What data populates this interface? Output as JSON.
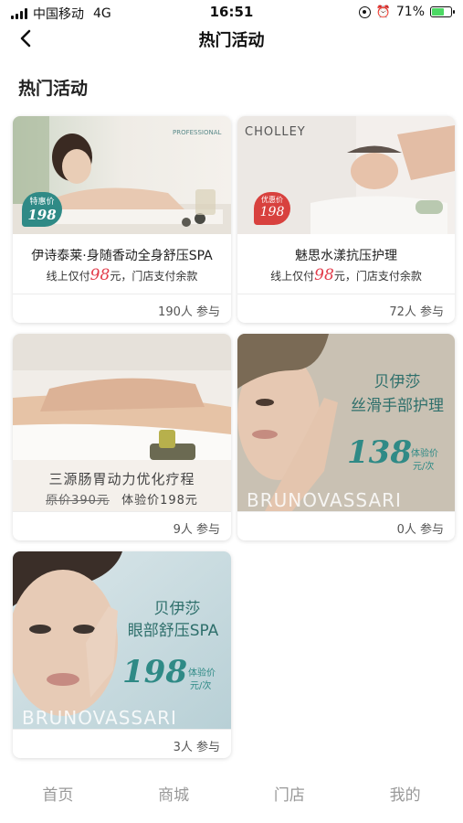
{
  "status_bar": {
    "carrier": "中国移动",
    "network": "4G",
    "time": "16:51",
    "battery": "71%",
    "battery_level": 0.71,
    "battery_color": "#4cd964"
  },
  "nav": {
    "back_icon": "chevron-left-icon",
    "title": "热门活动"
  },
  "section": {
    "title": "热门活动"
  },
  "cards": [
    {
      "badge_top": "特惠价",
      "badge_price": "198",
      "brand_text": "PROFESSIONAL",
      "name": "伊诗泰莱·身随香动全身舒压SPA",
      "price_prefix": "线上仅付",
      "price_value": "98",
      "price_suffix": "元，门店支付余款",
      "participants": "190人 参与"
    },
    {
      "brand_text": "CHOLLEY",
      "badge_top": "优惠价",
      "badge_price": "198",
      "name": "魅思水漾抗压护理",
      "price_prefix": "线上仅付",
      "price_value": "98",
      "price_suffix": "元，门店支付余款",
      "participants": "72人 参与"
    },
    {
      "caption": "三源肠胃动力优化疗程",
      "original_price": "原价390元",
      "trial_price": "体验价198元",
      "participants": "9人 参与"
    },
    {
      "title_line1": "贝伊莎",
      "title_line2": "丝滑手部护理",
      "price": "138",
      "unit_line1": "体验价",
      "unit_line2": "元/次",
      "brand_text": "BRUNOVASSARI",
      "participants": "0人 参与"
    },
    {
      "title_line1": "贝伊莎",
      "title_line2": "眼部舒压SPA",
      "price": "198",
      "unit_line1": "体验价",
      "unit_line2": "元/次",
      "brand_text": "BRUNOVASSARI",
      "participants": "3人 参与"
    }
  ],
  "tabs": [
    {
      "label": "首页"
    },
    {
      "label": "商城"
    },
    {
      "label": "门店"
    },
    {
      "label": "我的"
    }
  ],
  "colors": {
    "accent_red": "#e23b4a",
    "teal": "#2f8a86"
  }
}
